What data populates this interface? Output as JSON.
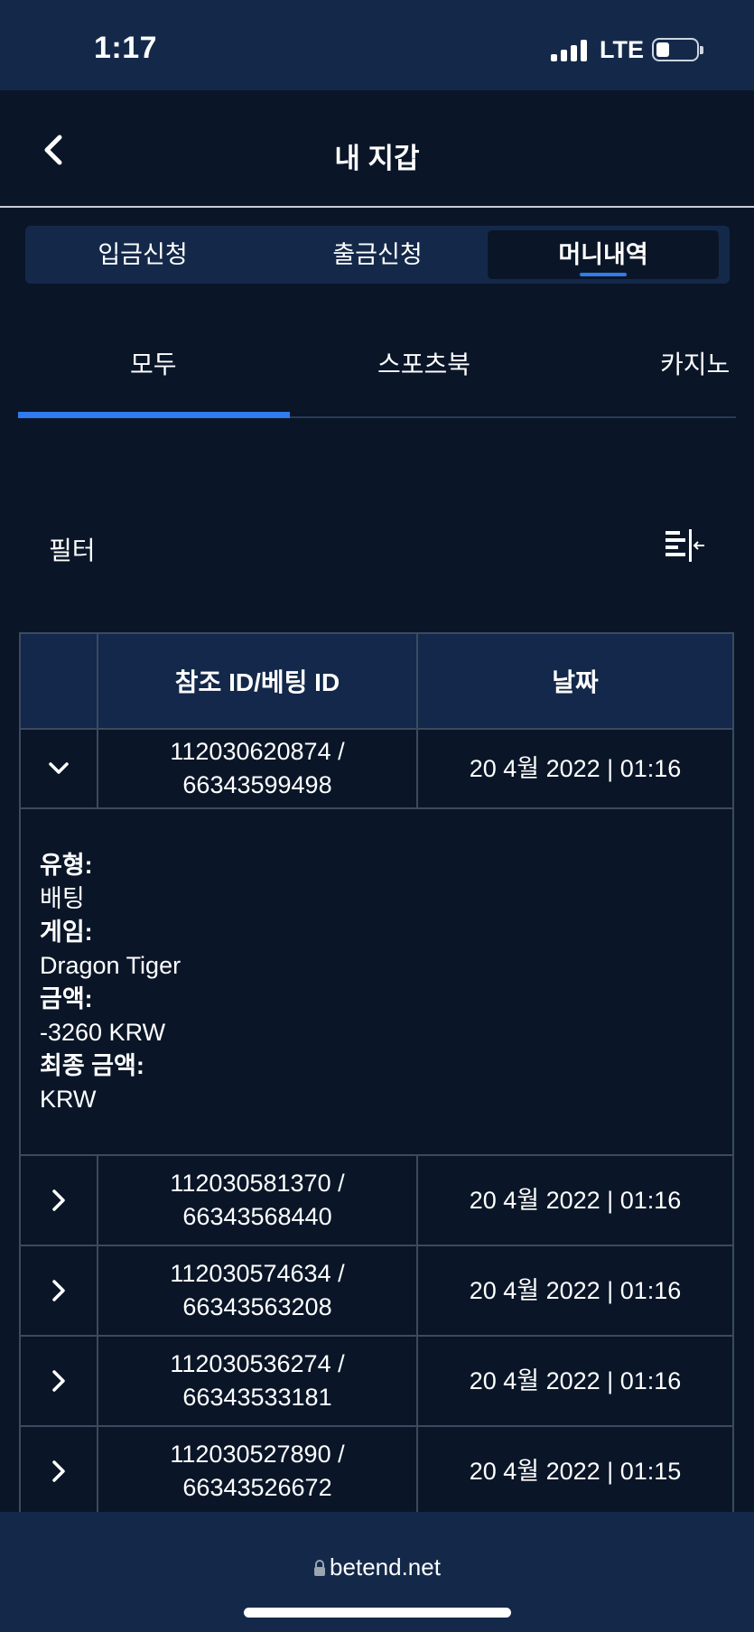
{
  "status": {
    "time": "1:17",
    "network": "LTE"
  },
  "header": {
    "title": "내 지갑"
  },
  "segments": [
    {
      "label": "입금신청",
      "active": false
    },
    {
      "label": "출금신청",
      "active": false
    },
    {
      "label": "머니내역",
      "active": true
    }
  ],
  "tabs": [
    {
      "label": "모두",
      "active": true
    },
    {
      "label": "스포츠북",
      "active": false
    },
    {
      "label": "카지노",
      "active": false
    }
  ],
  "filter": {
    "label": "필터"
  },
  "table": {
    "headers": [
      "",
      "참조 ID/베팅 ID",
      "날짜"
    ],
    "rows": [
      {
        "ref": "112030620874 /",
        "bet": "66343599498",
        "date": "20 4월 2022 | 01:16",
        "expanded": true
      },
      {
        "ref": "112030581370 /",
        "bet": "66343568440",
        "date": "20 4월 2022 | 01:16",
        "expanded": false
      },
      {
        "ref": "112030574634 /",
        "bet": "66343563208",
        "date": "20 4월 2022 | 01:16",
        "expanded": false
      },
      {
        "ref": "112030536274 /",
        "bet": "66343533181",
        "date": "20 4월 2022 | 01:16",
        "expanded": false
      },
      {
        "ref": "112030527890 /",
        "bet": "66343526672",
        "date": "20 4월 2022 | 01:15",
        "expanded": false
      }
    ],
    "detail": {
      "type_label": "유형:",
      "type_value": "배팅",
      "game_label": "게임:",
      "game_value": "Dragon Tiger",
      "amount_label": "금액:",
      "amount_value": "-3260 KRW",
      "final_label": "최종 금액:",
      "final_value": "KRW"
    }
  },
  "browser": {
    "url": "betend.net"
  },
  "colors": {
    "background": "#0a1628",
    "bar": "#14294a",
    "accent": "#2f7bf0",
    "border": "#3b4a60"
  },
  "icons": [
    "back-chevron-icon",
    "filter-icon",
    "chevron-down-icon",
    "chevron-right-icon",
    "lock-icon"
  ]
}
